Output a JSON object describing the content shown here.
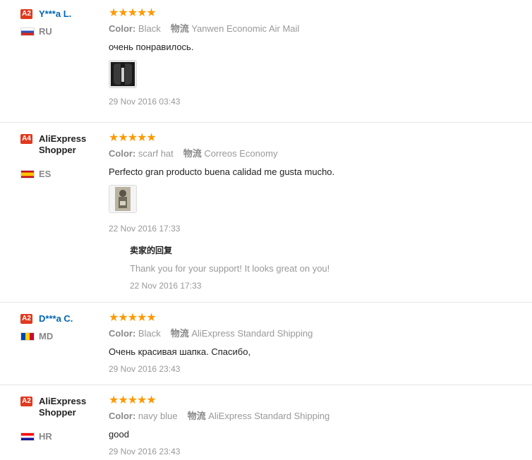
{
  "labels": {
    "color": "Color:",
    "shipping": "物流"
  },
  "reviews": [
    {
      "level": "A2",
      "name": "Y***a L.",
      "country": "RU",
      "stars": "★★★★★",
      "color": "Black",
      "shipping": "Yanwen Economic Air Mail",
      "text": "очень понравилось.",
      "date": "29 Nov 2016 03:43"
    },
    {
      "level": "A4",
      "name": "AliExpress Shopper",
      "country": "ES",
      "stars": "★★★★★",
      "color": "scarf hat",
      "shipping": "Correos Economy",
      "text": "Perfecto gran producto buena calidad me gusta mucho.",
      "date": "22 Nov 2016 17:33",
      "reply": {
        "title": "卖家的回复",
        "text": "Thank you for your support! It looks great on you!",
        "date": "22 Nov 2016 17:33"
      }
    },
    {
      "level": "A2",
      "name": "D***a C.",
      "country": "MD",
      "stars": "★★★★★",
      "color": "Black",
      "shipping": "AliExpress Standard Shipping",
      "text": "Очень красивая шапка. Спасибо,",
      "date": "29 Nov 2016 23:43"
    },
    {
      "level": "A2",
      "name": "AliExpress Shopper",
      "country": "HR",
      "stars": "★★★★★",
      "color": "navy blue",
      "shipping": "AliExpress Standard Shipping",
      "text": "good",
      "date": "29 Nov 2016 23:43"
    }
  ]
}
